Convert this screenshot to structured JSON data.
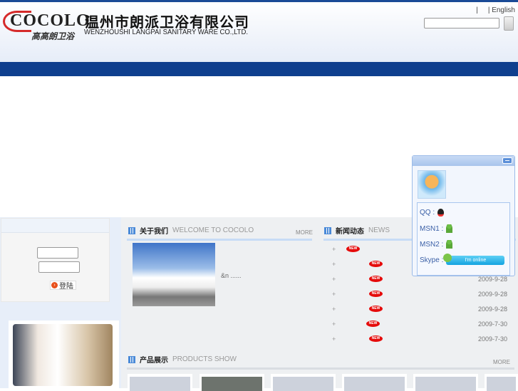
{
  "header": {
    "logo_text": "COCOLO",
    "logo_cn": "高高朗卫浴",
    "company_cn": "温州市朗派卫浴有限公司",
    "company_en": "WENZHOUSHI LANGPAI  SANITARY WARE  CO.,LTD.",
    "links": [
      "|",
      "| English"
    ],
    "search_value": ""
  },
  "login": {
    "button_label": "登陆",
    "username": "",
    "password": ""
  },
  "about": {
    "title_cn": "关于我们",
    "title_en": "WELCOME TO COCOLO",
    "more": "MORE",
    "text": "&n ......"
  },
  "news": {
    "title_cn": "新闻动态",
    "title_en": "NEWS",
    "badge": "NEW",
    "items": [
      {
        "date": ""
      },
      {
        "date": ""
      },
      {
        "date": "2009-9-28"
      },
      {
        "date": "2009-9-28"
      },
      {
        "date": "2009-9-28"
      },
      {
        "date": "2009-7-30"
      },
      {
        "date": "2009-7-30"
      }
    ]
  },
  "products": {
    "title_cn": "产品展示",
    "title_en": "PRODUCTS SHOW",
    "more": "MORE"
  },
  "service": {
    "qq_label": "QQ :",
    "msn1_label": "MSN1 :",
    "msn2_label": "MSN2 :",
    "skype_label": "Skype :",
    "skype_status": "I'm online"
  }
}
